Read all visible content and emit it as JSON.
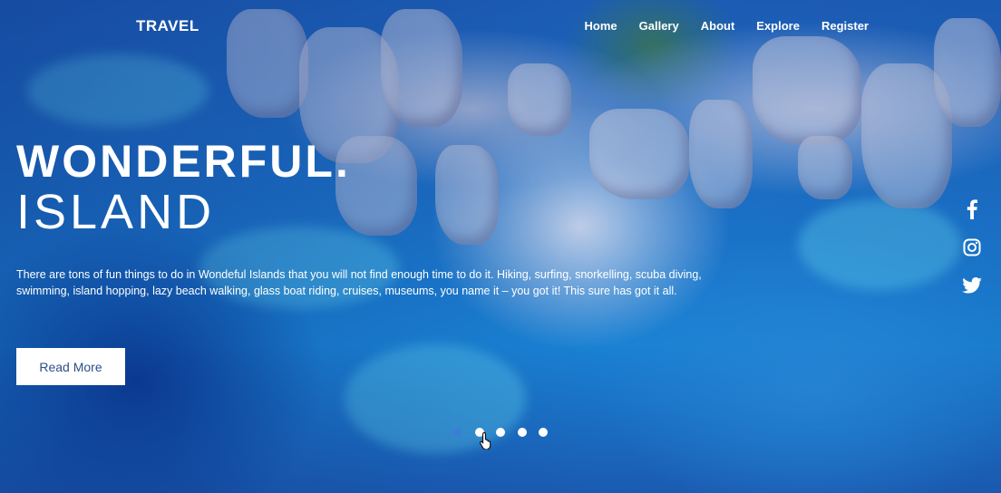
{
  "brand": "TRAVEL",
  "nav": {
    "items": [
      {
        "label": "Home"
      },
      {
        "label": "Gallery"
      },
      {
        "label": "About"
      },
      {
        "label": "Explore"
      },
      {
        "label": "Register"
      }
    ]
  },
  "hero": {
    "title_line1": "WONDERFUL.",
    "title_line2": "ISLAND",
    "description": "There are tons of fun things to do in Wondeful Islands that you will not find enough time to do it. Hiking, surfing, snorkelling, scuba diving, swimming, island hopping, lazy beach walking, glass boat riding, cruises, museums, you name it – you got it! This sure has got it all.",
    "cta_label": "Read More"
  },
  "social": {
    "icons": [
      "facebook-icon",
      "instagram-icon",
      "twitter-icon"
    ]
  },
  "carousel": {
    "slide_count": 5,
    "active_index": 0
  },
  "colors": {
    "button_text": "#2a4f8a",
    "active_dot": "#3a7fd6",
    "text": "#ffffff"
  }
}
